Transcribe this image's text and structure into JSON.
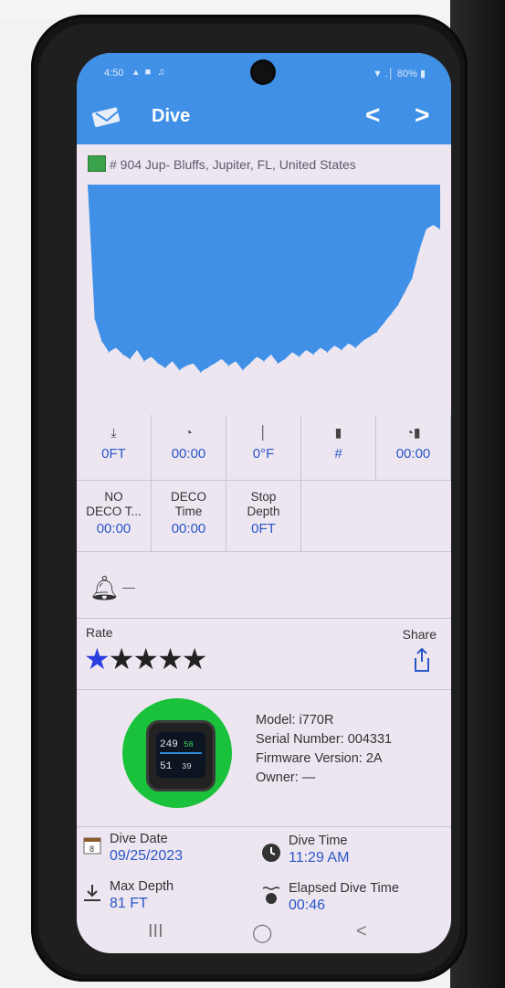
{
  "status_bar": {
    "time": "4:50",
    "icons": "▴ ■ ♫",
    "right": "▼ .│ 80% ▮"
  },
  "app_bar": {
    "title": "Dive",
    "prev_icon": "chevron-left-icon",
    "next_icon": "chevron-right-icon",
    "logo_icon": "app-logo-icon",
    "prev_glyph": "<",
    "next_glyph": ">"
  },
  "location": {
    "text": "# 904  Jup- Bluffs, Jupiter, FL, United States",
    "flag_icon": "dive-flag-icon"
  },
  "chart_data": {
    "type": "area",
    "title": "",
    "xlabel": "",
    "ylabel": "",
    "fill_color": "#3f90e6",
    "x": [
      0,
      2,
      4,
      6,
      8,
      10,
      12,
      14,
      16,
      18,
      20,
      22,
      24,
      26,
      28,
      30,
      32,
      34,
      36,
      38,
      40,
      42,
      44,
      46,
      48,
      50,
      52,
      54,
      56,
      58,
      60,
      62,
      64,
      66,
      68,
      70,
      72,
      74,
      76,
      78,
      80,
      82,
      84,
      86,
      88,
      90,
      92,
      94,
      96,
      98,
      100
    ],
    "y": [
      0,
      60,
      70,
      75,
      73,
      76,
      78,
      74,
      79,
      77,
      80,
      82,
      79,
      83,
      81,
      80,
      84,
      82,
      80,
      78,
      81,
      79,
      83,
      80,
      77,
      79,
      76,
      80,
      78,
      75,
      77,
      74,
      76,
      73,
      75,
      72,
      74,
      71,
      73,
      70,
      68,
      66,
      62,
      58,
      54,
      48,
      42,
      30,
      20,
      18,
      20
    ],
    "ylim": [
      0,
      90
    ]
  },
  "stats_row1": [
    {
      "icon": "depth-down-icon",
      "glyph": "⤓",
      "value": "0FT"
    },
    {
      "icon": "surface-timer-icon",
      "glyph": "◔",
      "value": "00:00"
    },
    {
      "icon": "temperature-icon",
      "glyph": "│",
      "value": "0°F"
    },
    {
      "icon": "tank-icon",
      "glyph": "▮",
      "value": "#"
    },
    {
      "icon": "tank-timer-icon",
      "glyph": "◔▮",
      "value": "00:00"
    }
  ],
  "stats_row2": [
    {
      "label1": "NO",
      "label2": "DECO T...",
      "value": "00:00"
    },
    {
      "label1": "DECO",
      "label2": "Time",
      "value": "00:00"
    },
    {
      "label1": "Stop",
      "label2": "Depth",
      "value": "0FT"
    }
  ],
  "alarm": {
    "icon": "bell-icon",
    "value": "—"
  },
  "rating": {
    "label": "Rate",
    "stars_on": "★",
    "stars_off": "★★★★",
    "share_label": "Share",
    "share_icon": "share-icon"
  },
  "device": {
    "model": "Model: i770R",
    "serial": "Serial Number: 004331",
    "firmware": "Firmware Version: 2A",
    "owner": "Owner: —",
    "image_icon": "dive-computer-icon"
  },
  "meta": {
    "dive_date_label": "Dive Date",
    "dive_date": "09/25/2023",
    "dive_time_label": "Dive Time",
    "dive_time": "11:29 AM",
    "max_depth_label": "Max Depth",
    "max_depth": "81 FT",
    "elapsed_label": "Elapsed Dive Time",
    "elapsed": "00:46"
  },
  "bottom_nav": {
    "recents": "III",
    "home": "◯",
    "back": "<"
  }
}
